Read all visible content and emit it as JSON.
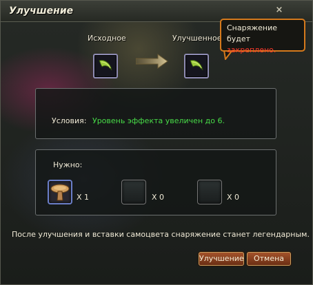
{
  "window": {
    "title": "Улучшение",
    "close_glyph": "×"
  },
  "source": {
    "label": "Исходное",
    "icon": "horn-item-icon"
  },
  "result": {
    "label": "Улучшенное",
    "icon": "horn-item-icon"
  },
  "tooltip": {
    "line1": "Снаряжение будет",
    "line2": "закреплено.",
    "line2_color": "#ff3b2a"
  },
  "conditions": {
    "label": "Условия:",
    "text": "Уровень эффекта увеличен до 6.",
    "text_color": "#48dc48"
  },
  "requirements": {
    "label": "Нужно:",
    "items": [
      {
        "icon": "mushroom-material-icon",
        "count": "X 1"
      },
      {
        "icon": "empty-slot",
        "count": "X 0"
      },
      {
        "icon": "empty-slot",
        "count": "X 0"
      }
    ]
  },
  "footer_text": "После улучшения и вставки самоцвета снаряжение станет легендарным.",
  "buttons": {
    "upgrade": "Улучшение",
    "cancel": "Отмена"
  }
}
